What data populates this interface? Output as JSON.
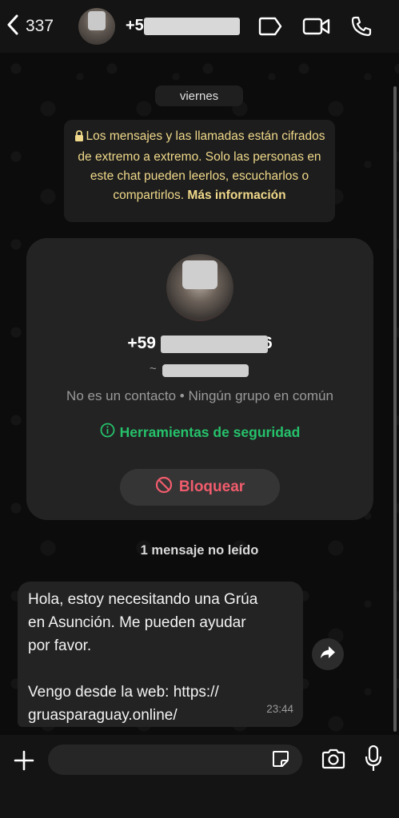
{
  "header": {
    "back_count": "337",
    "contact_number": "+59",
    "icons": [
      "chevron-left-icon",
      "label-tag-icon",
      "video-call-icon",
      "phone-icon"
    ]
  },
  "chat": {
    "day_label": "viernes",
    "encryption_notice": {
      "text": "Los mensajes y las llamadas están cifrados de extremo a extremo. Solo las personas en este chat pueden leerlos, escucharlos o compartirlos.",
      "link": "Más información"
    },
    "contact_card": {
      "number_prefix": "+59",
      "number_suffix": "6",
      "name_prefix": "~",
      "info": "No es un contacto • Ningún grupo en común",
      "security_tools": "Herramientas de seguridad",
      "block_label": "Bloquear"
    },
    "unread_label": "1 mensaje no leído",
    "message": {
      "lines": [
        "Hola, estoy necesitando una Grúa",
        "en Asunción. Me pueden ayudar",
        "por favor."
      ],
      "lines2": [
        "Vengo desde la web: https://",
        "gruasparaguay.online/"
      ],
      "time": "23:44"
    }
  },
  "input": {
    "placeholder": ""
  },
  "colors": {
    "accent_green": "#25c26b",
    "block_red": "#f15c6d",
    "encryption_text": "#f0d98a"
  }
}
